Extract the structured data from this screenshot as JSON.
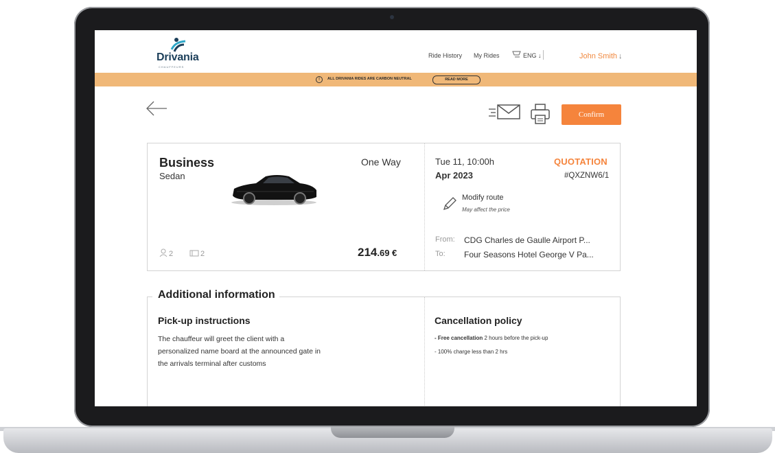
{
  "header": {
    "logo_name": "Drivania",
    "logo_sub": "CHAUFFEURS",
    "nav_ride_history": "Ride History",
    "nav_my_rides": "My Rides",
    "language": "ENG ↓",
    "user_name": "John Smith",
    "user_arrow": "↓"
  },
  "banner": {
    "text": "ALL DRIVANIA RIDES ARE CARBON NEUTRAL",
    "button": "READ MORE"
  },
  "toolbar": {
    "confirm_label": "Confirm"
  },
  "ride": {
    "class": "Business",
    "vehicle_type": "Sedan",
    "trip_type": "One Way",
    "passengers": "2",
    "luggage": "2",
    "price_main": "214",
    "price_decimals": ".69 €",
    "date_line1": "Tue 11, 10:00h",
    "date_line2": "Apr 2023",
    "status": "QUOTATION",
    "reference": "#QXZNW6/1",
    "modify_label": "Modify route",
    "modify_sub": "May affect the price",
    "from_label": "From:",
    "from_value": "CDG Charles de Gaulle Airport P...",
    "to_label": "To:",
    "to_value": "Four Seasons Hotel George V Pa..."
  },
  "info": {
    "title": "Additional information",
    "pickup_heading": "Pick-up instructions",
    "pickup_text": "The chauffeur will greet the client with a personalized name board at the announced gate in the arrivals terminal after customs",
    "cancel_heading": "Cancellation policy",
    "cancel_line1_bold": "- Free cancellation",
    "cancel_line1_rest": " 2 hours before the pick-up",
    "cancel_line2": "- 100% charge less than 2 hrs"
  },
  "colors": {
    "accent": "#f5843c",
    "banner": "#f0b878",
    "brand": "#1c3f5a"
  }
}
